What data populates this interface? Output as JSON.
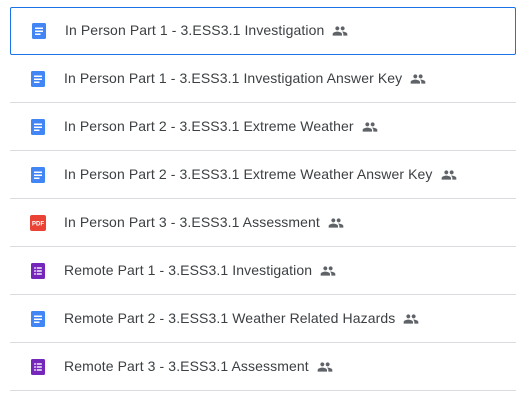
{
  "files": [
    {
      "name": "In Person Part 1 - 3.ESS3.1 Investigation",
      "type": "doc-icon",
      "shared": "shared-people-icon",
      "selected": true
    },
    {
      "name": "In Person Part 1 - 3.ESS3.1 Investigation Answer Key",
      "type": "doc-icon",
      "shared": "shared-people-icon"
    },
    {
      "name": "In Person Part 2 - 3.ESS3.1 Extreme Weather",
      "type": "doc-icon",
      "shared": "shared-people-icon"
    },
    {
      "name": "In Person Part 2 - 3.ESS3.1 Extreme Weather Answer Key",
      "type": "doc-icon",
      "shared": "shared-people-icon"
    },
    {
      "name": "In Person Part 3 - 3.ESS3.1 Assessment",
      "type": "pdf-icon",
      "type_label": "PDF",
      "shared": "shared-people-icon"
    },
    {
      "name": "Remote Part 1 - 3.ESS3.1 Investigation",
      "type": "form-icon",
      "shared": "shared-people-icon"
    },
    {
      "name": "Remote Part 2 - 3.ESS3.1 Weather Related Hazards",
      "type": "doc-icon",
      "shared": "shared-people-icon"
    },
    {
      "name": "Remote Part 3 - 3.ESS3.1 Assessment",
      "type": "form-icon",
      "shared": "shared-people-icon"
    }
  ],
  "colors": {
    "doc": "#4285f4",
    "pdf": "#ea4335",
    "form": "#7627bb",
    "text": "#3c4043",
    "divider": "#dadce0",
    "selection": "#1a73e8",
    "shared_icon": "#5f6368"
  }
}
